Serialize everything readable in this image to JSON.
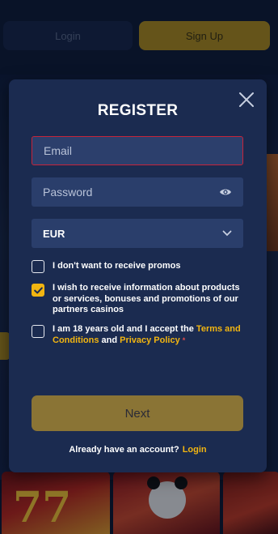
{
  "background": {
    "header": {
      "login_label": "Login",
      "signup_label": "Sign Up"
    },
    "game_tiles": [
      "slot-sevens",
      "panda-slot",
      "slot-tile"
    ]
  },
  "modal": {
    "title": "REGISTER",
    "close_icon": "close-icon",
    "email": {
      "placeholder": "Email",
      "value": ""
    },
    "password": {
      "placeholder": "Password",
      "value": "",
      "toggle_icon": "eye-icon"
    },
    "currency": {
      "selected": "EUR",
      "icon": "chevron-down-icon"
    },
    "checkboxes": {
      "no_promos": {
        "label": "I don't want to receive promos",
        "checked": false
      },
      "receive_info": {
        "label": "I wish to receive information about products or services, bonuses and promotions of our partners casinos",
        "checked": true
      },
      "age_terms": {
        "prefix": "I am 18 years old and I accept the ",
        "terms_link": "Terms and Conditions",
        "and": " and ",
        "privacy_link": "Privacy Policy",
        "required_mark": "*",
        "checked": false
      }
    },
    "next_label": "Next",
    "footer": {
      "text": "Already have an account?",
      "login_link": "Login"
    }
  },
  "colors": {
    "accent": "#f2b511",
    "modal_bg": "#1b2b50",
    "field_bg": "#2a3e6b",
    "error_border": "#c6243a",
    "next_button": "#8a7435"
  }
}
